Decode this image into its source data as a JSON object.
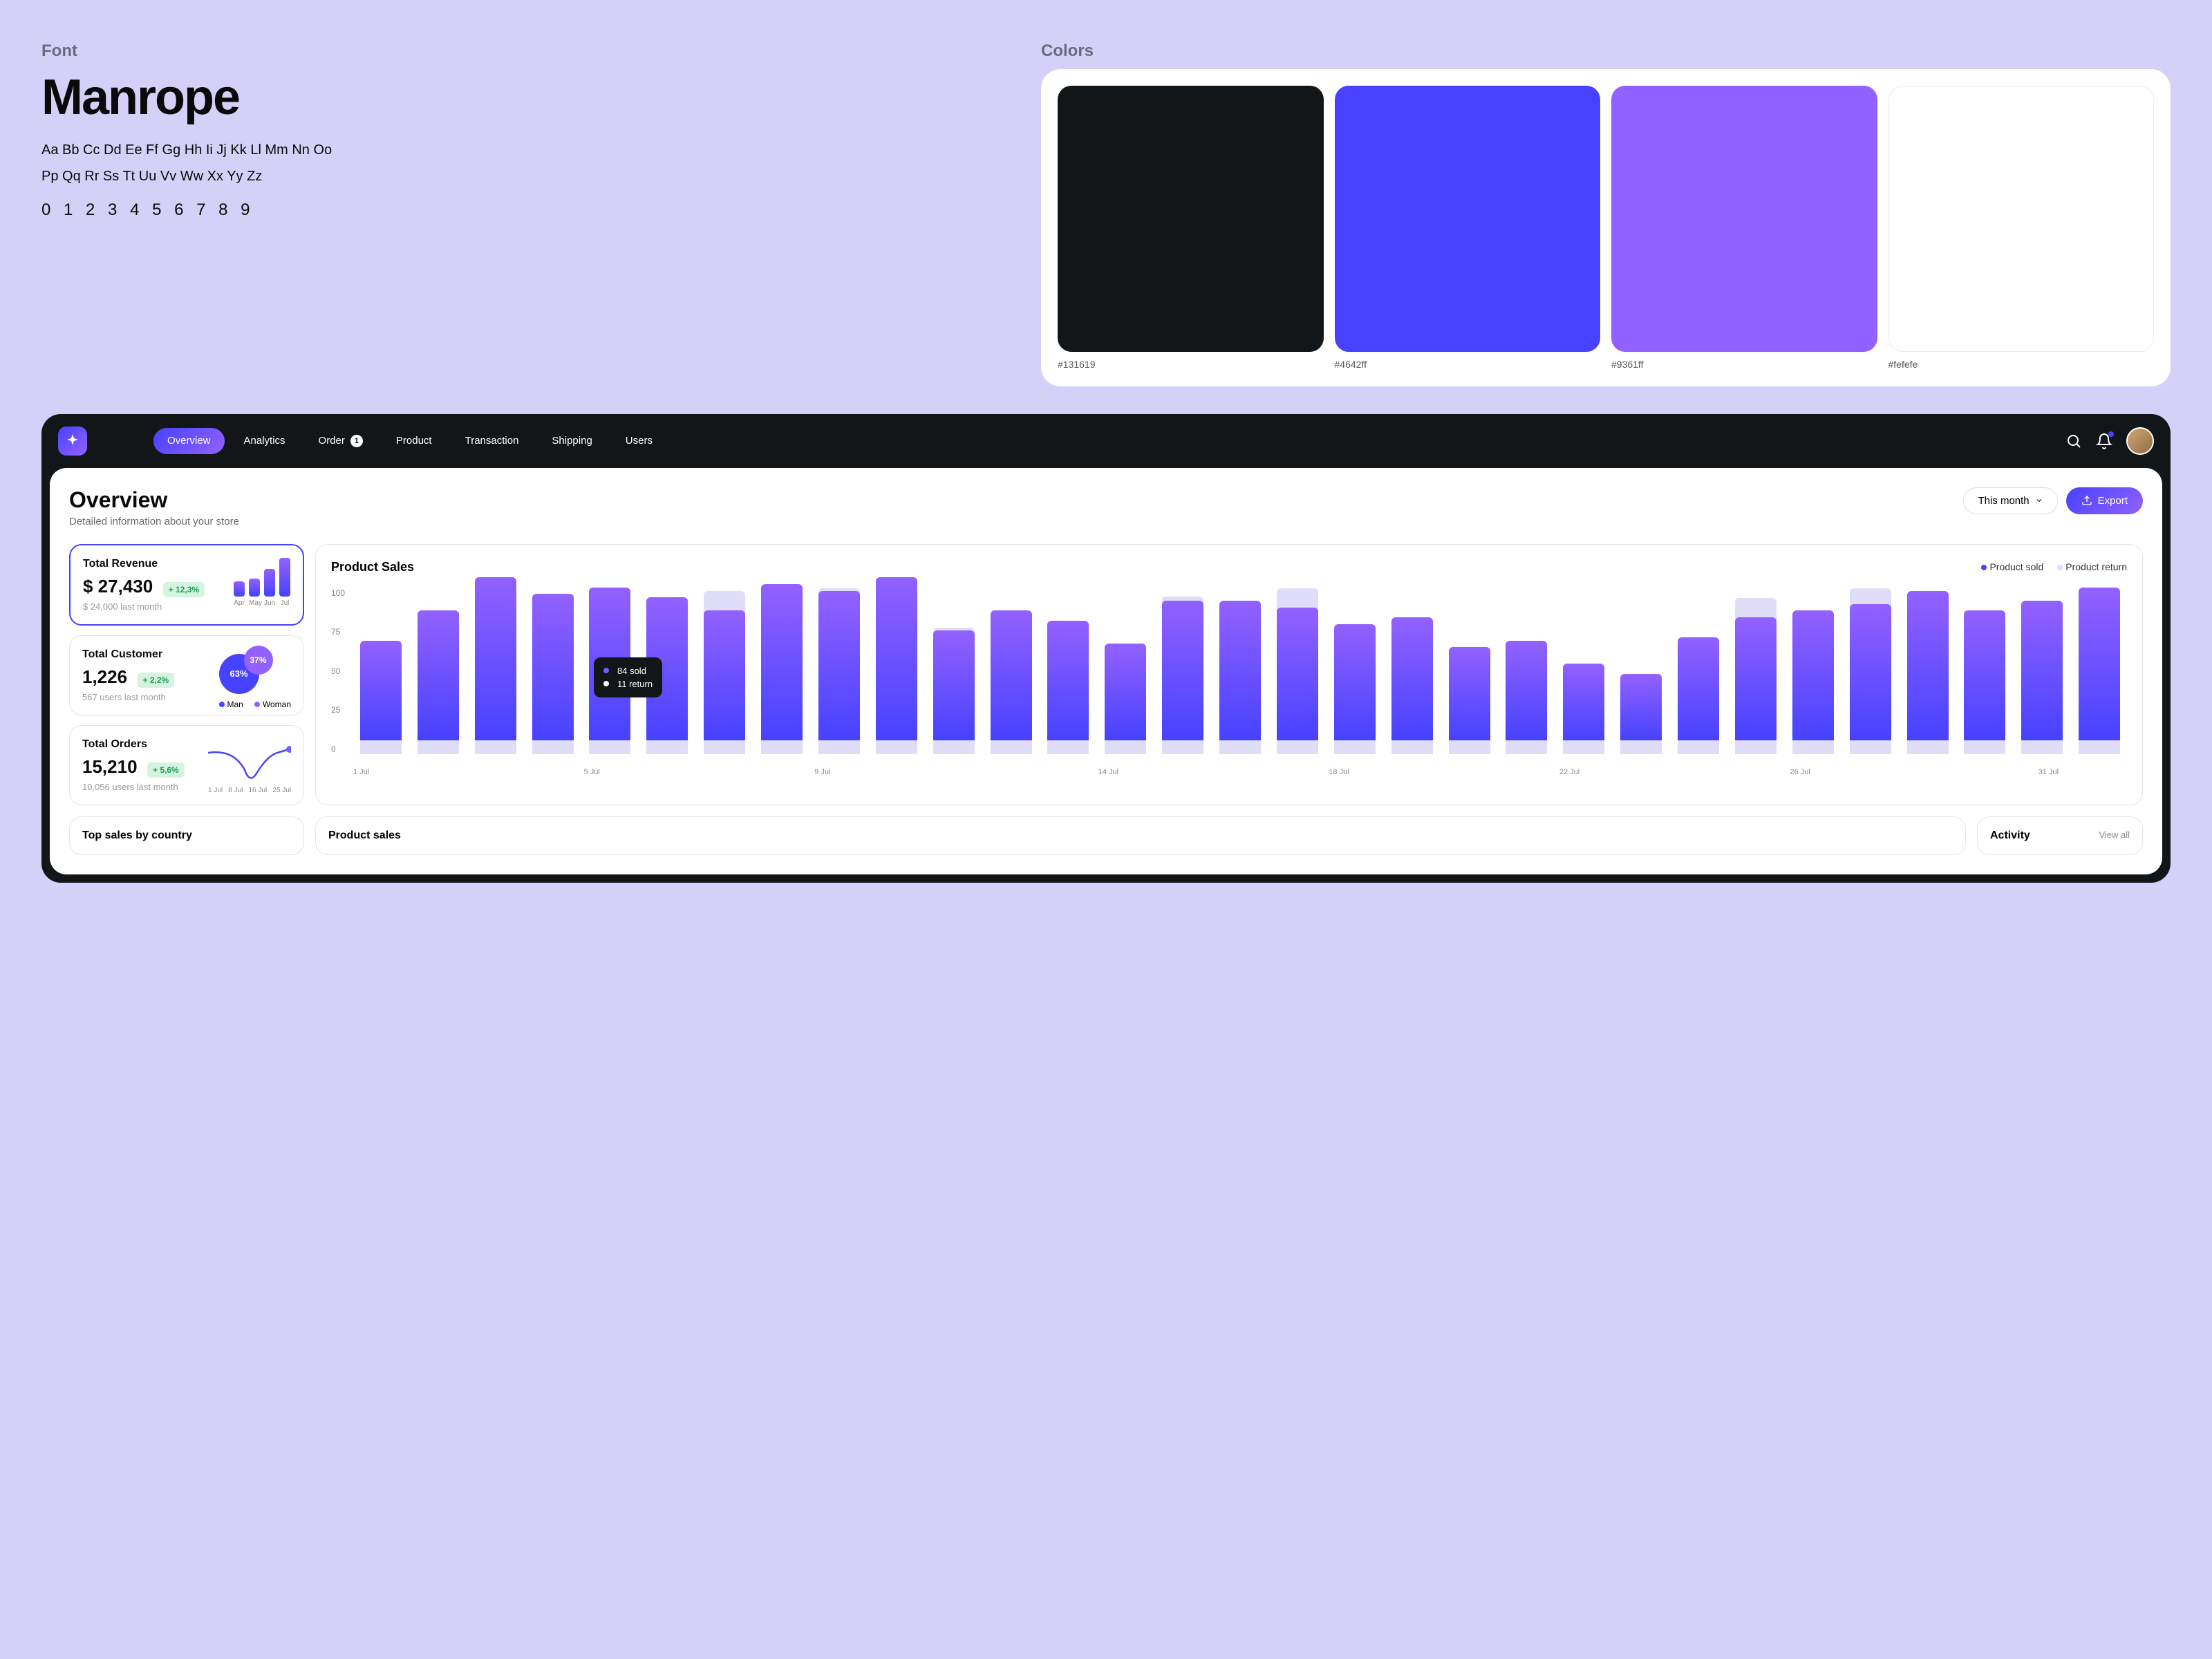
{
  "font_section": {
    "label": "Font",
    "name": "Manrope",
    "sample_line1": "Aa Bb Cc Dd Ee Ff Gg Hh Ii Jj Kk Ll Mm Nn Oo",
    "sample_line2": "Pp Qq Rr Ss Tt Uu Vv Ww Xx Yy Zz",
    "numbers": "0 1 2 3 4 5 6 7 8 9"
  },
  "colors_section": {
    "label": "Colors",
    "swatches": [
      {
        "hex": "#131619"
      },
      {
        "hex": "#4642ff"
      },
      {
        "hex": "#9361ff"
      },
      {
        "hex": "#fefefe"
      }
    ]
  },
  "nav": {
    "items": [
      "Overview",
      "Analytics",
      "Order",
      "Product",
      "Transaction",
      "Shipping",
      "Users"
    ],
    "order_badge": "1"
  },
  "page": {
    "title": "Overview",
    "subtitle": "Detailed information about your store",
    "period": "This month",
    "export": "Export"
  },
  "stats": {
    "revenue": {
      "label": "Total Revenue",
      "value": "$ 27,430",
      "delta": "+ 12,3%",
      "prev": "$ 24,000 last month",
      "bars": [
        "Apr",
        "May",
        "Jun",
        "Jul"
      ]
    },
    "customer": {
      "label": "Total Customer",
      "value": "1,226",
      "delta": "+ 2,2%",
      "prev": "567 users last month",
      "pie_big": "63%",
      "pie_small": "37%",
      "legend_a": "Man",
      "legend_b": "Woman"
    },
    "orders": {
      "label": "Total Orders",
      "value": "15,210",
      "delta": "+ 5,6%",
      "prev": "10,056 users last month",
      "xlabels": [
        "1 Jul",
        "8 Jul",
        "16 Jul",
        "25 Jul"
      ]
    }
  },
  "chart": {
    "title": "Product Sales",
    "legend_sold": "Product sold",
    "legend_return": "Product return",
    "ylabels": [
      "100",
      "75",
      "50",
      "25",
      "0"
    ],
    "xlabels": [
      "1 Jul",
      "5 Jul",
      "9 Jul",
      "14 Jul",
      "18 Jul",
      "22 Jul",
      "26 Jul",
      "31 Jul"
    ],
    "tooltip_sold": "84 sold",
    "tooltip_return": "11 return"
  },
  "bottom": {
    "top_sales": "Top sales by country",
    "product_sales": "Product sales",
    "activity": "Activity",
    "view_all": "View all"
  },
  "chart_data": {
    "type": "bar",
    "title": "Product Sales",
    "xlabel": "",
    "ylabel": "",
    "ylim": [
      0,
      100
    ],
    "categories": [
      "1 Jul",
      "2 Jul",
      "3 Jul",
      "4 Jul",
      "5 Jul",
      "6 Jul",
      "7 Jul",
      "8 Jul",
      "9 Jul",
      "10 Jul",
      "11 Jul",
      "12 Jul",
      "13 Jul",
      "14 Jul",
      "15 Jul",
      "16 Jul",
      "17 Jul",
      "18 Jul",
      "19 Jul",
      "20 Jul",
      "21 Jul",
      "22 Jul",
      "23 Jul",
      "24 Jul",
      "25 Jul",
      "26 Jul",
      "27 Jul",
      "28 Jul",
      "29 Jul",
      "30 Jul",
      "31 Jul"
    ],
    "series": [
      {
        "name": "Product sold",
        "values": [
          60,
          78,
          98,
          88,
          92,
          86,
          78,
          94,
          90,
          98,
          66,
          78,
          72,
          58,
          84,
          84,
          80,
          70,
          74,
          56,
          60,
          46,
          40,
          62,
          74,
          78,
          82,
          90,
          78,
          84,
          92
        ]
      },
      {
        "name": "Product return",
        "values": [
          6,
          8,
          4,
          6,
          8,
          8,
          100,
          8,
          10,
          6,
          10,
          8,
          6,
          8,
          11,
          6,
          92,
          8,
          6,
          6,
          6,
          8,
          6,
          8,
          78,
          8,
          92,
          6,
          8,
          6,
          6
        ]
      }
    ]
  }
}
